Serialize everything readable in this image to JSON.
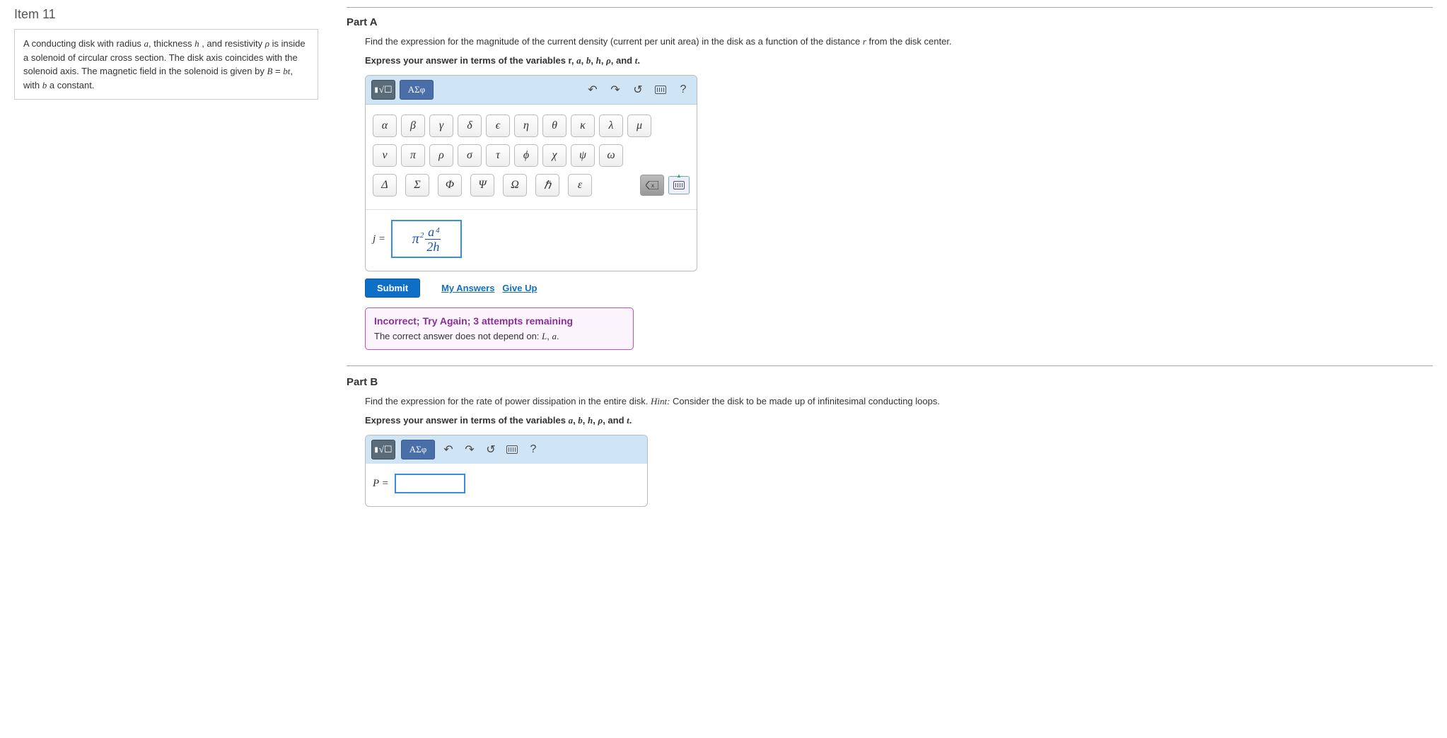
{
  "item_title": "Item 11",
  "problem_html": "A conducting disk with radius <span class='ital'>a</span>, thickness <span class='ital'>h</span> , and resistivity <span class='ital'>ρ</span> is inside a solenoid of circular cross section. The disk axis coincides with the solenoid axis. The magnetic field in the solenoid is given by <span class='ital'>B</span> = <span class='ital'>bt</span>, with <span class='ital'>b</span> a constant.",
  "partA": {
    "heading": "Part A",
    "prompt": "Find the expression for the magnitude of the current density (current per unit area) in the disk as a function of the distance <span class='ital'>r</span> from the disk center.",
    "express": "Express your answer in terms of the variables r, <span class='ital'>a</span>, <span class='ital'>b</span>, <span class='ital'>h</span>, <span class='ital'>ρ</span>, and <span class='ital'>t</span>.",
    "ans_label": "j",
    "ans_expr": {
      "pi_exp": "2",
      "num_sup": "4",
      "num": "a",
      "den": "2h"
    }
  },
  "toolbar": {
    "template_label": "√☐",
    "greek_tab": "ΑΣφ",
    "help": "?"
  },
  "greek_row1": [
    "α",
    "β",
    "γ",
    "δ",
    "ϵ",
    "η",
    "θ",
    "κ",
    "λ",
    "μ"
  ],
  "greek_row2": [
    "ν",
    "π",
    "ρ",
    "σ",
    "τ",
    "ϕ",
    "χ",
    "ψ",
    "ω"
  ],
  "greek_row3": [
    "Δ",
    "Σ",
    "Φ",
    "Ψ",
    "Ω",
    "ℏ",
    "ε"
  ],
  "actions": {
    "submit": "Submit",
    "my_answers": "My Answers",
    "give_up": "Give Up"
  },
  "feedback": {
    "title": "Incorrect; Try Again; 3 attempts remaining",
    "msg": "The correct answer does not depend on: <span class='ital'>L</span>, <span class='ital'>a</span>."
  },
  "partB": {
    "heading": "Part B",
    "prompt": "Find the expression for the rate of power dissipation in the entire disk. <span class='ital'>Hint:</span> Consider the disk to be made up of infinitesimal conducting loops.",
    "express": "Express your answer in terms of the variables <span class='ital'>a</span>, <span class='ital'>b</span>, <span class='ital'>h</span>, <span class='ital'>ρ</span>, and <span class='ital'>t</span>.",
    "ans_label": "P"
  }
}
